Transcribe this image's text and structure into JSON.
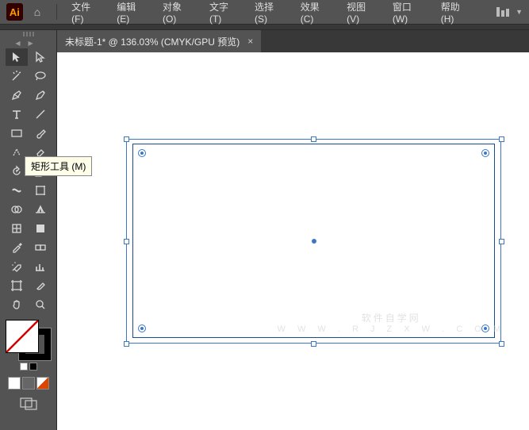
{
  "app": {
    "logo": "Ai"
  },
  "menu": [
    "文件(F)",
    "编辑(E)",
    "对象(O)",
    "文字(T)",
    "选择(S)",
    "效果(C)",
    "视图(V)",
    "窗口(W)",
    "帮助(H)"
  ],
  "tab": {
    "title": "未标题-1* @ 136.03% (CMYK/GPU 预览)",
    "close": "×"
  },
  "tooltip": "矩形工具 (M)",
  "watermark": {
    "line1": "软件自学网",
    "line2": "W W W . R J Z X W . C O M"
  }
}
